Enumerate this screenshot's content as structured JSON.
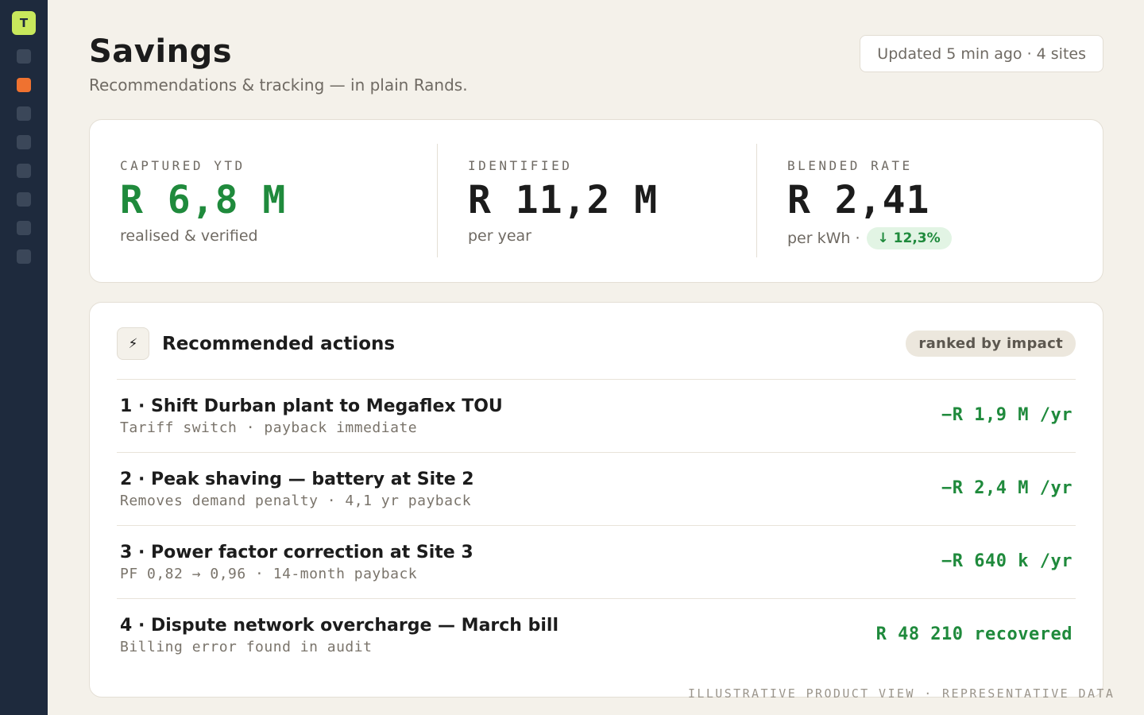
{
  "sidebar": {
    "logo_letter": "T",
    "nav_items": [
      {
        "icon": "nav-item-icon",
        "active": false
      },
      {
        "icon": "savings-icon",
        "active": true
      },
      {
        "icon": "nav-item-icon",
        "active": false
      },
      {
        "icon": "nav-item-icon",
        "active": false
      },
      {
        "icon": "nav-item-icon",
        "active": false
      },
      {
        "icon": "nav-item-icon",
        "active": false
      },
      {
        "icon": "nav-item-icon",
        "active": false
      },
      {
        "icon": "nav-item-icon",
        "active": false
      }
    ],
    "active_color": "#ef7230"
  },
  "header": {
    "title": "Savings",
    "subtitle": "Recommendations & tracking — in plain Rands.",
    "updated": "Updated 5 min ago · 4 sites"
  },
  "kpis": [
    {
      "label": "CAPTURED YTD",
      "value": "R 6,8 M",
      "sub": "realised & verified",
      "color": "#1f8a3c"
    },
    {
      "label": "IDENTIFIED",
      "value": "R 11,2 M",
      "sub": "per year"
    },
    {
      "label": "BLENDED RATE",
      "value": "R 2,41",
      "sub": "per kWh ·",
      "delta": "↓ 12,3%"
    }
  ],
  "actions": {
    "icon": "lightning-icon",
    "title": "Recommended actions",
    "badge": "ranked by impact",
    "items": [
      {
        "title": "1 · Shift Durban plant to Megaflex TOU",
        "sub": "Tariff switch · payback immediate",
        "value": "−R 1,9 M /yr"
      },
      {
        "title": "2 · Peak shaving — battery at Site 2",
        "sub": "Removes demand penalty · 4,1 yr payback",
        "value": "−R 2,4 M /yr"
      },
      {
        "title": "3 · Power factor correction at Site 3",
        "sub": "PF 0,82 → 0,96 · 14-month payback",
        "value": "−R 640 k /yr"
      },
      {
        "title": "4 · Dispute network overcharge — March bill",
        "sub": "Billing error found in audit",
        "value": "R 48 210 recovered"
      }
    ]
  },
  "footer": "ILLUSTRATIVE PRODUCT VIEW · REPRESENTATIVE DATA",
  "colors": {
    "positive": "#1f8a3c",
    "sidebar": "#1e2a3d",
    "logo": "#c8e85c"
  }
}
